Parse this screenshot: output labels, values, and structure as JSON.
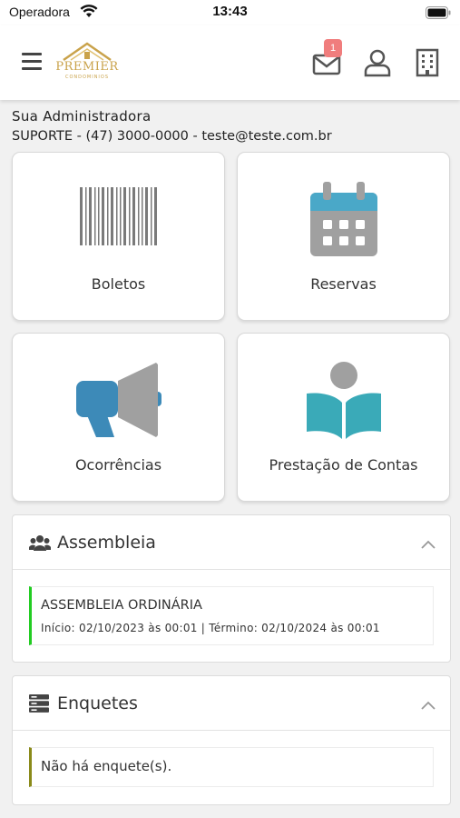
{
  "status_bar": {
    "carrier": "Operadora",
    "time": "13:43"
  },
  "header": {
    "logo_text": "PREMIER",
    "logo_subtext": "CONDOMINIOS",
    "mail_badge": "1"
  },
  "admin": {
    "title": "Sua Administradora",
    "contact": "SUPORTE - (47) 3000-0000 - teste@teste.com.br"
  },
  "tiles": [
    {
      "label": "Boletos",
      "icon": "barcode-icon"
    },
    {
      "label": "Reservas",
      "icon": "calendar-icon"
    },
    {
      "label": "Ocorrências",
      "icon": "megaphone-icon"
    },
    {
      "label": "Prestação de Contas",
      "icon": "reading-person-icon"
    }
  ],
  "assembleia": {
    "title": "Assembleia",
    "entries": [
      {
        "title": "ASSEMBLEIA ORDINÁRIA",
        "dates": "Início: 02/10/2023 às 00:01 | Término: 02/10/2024 às 00:01"
      }
    ]
  },
  "enquetes": {
    "title": "Enquetes",
    "empty_text": "Não há enquete(s)."
  },
  "colors": {
    "gold": "#c9a24a",
    "badge": "#f07d7d",
    "assembleia_accent": "#22cc22",
    "enquete_accent": "#8a8a1a",
    "calendar_blue": "#4aa8c8",
    "megaphone_blue": "#3d8ab8",
    "book_teal": "#3aaab8"
  }
}
